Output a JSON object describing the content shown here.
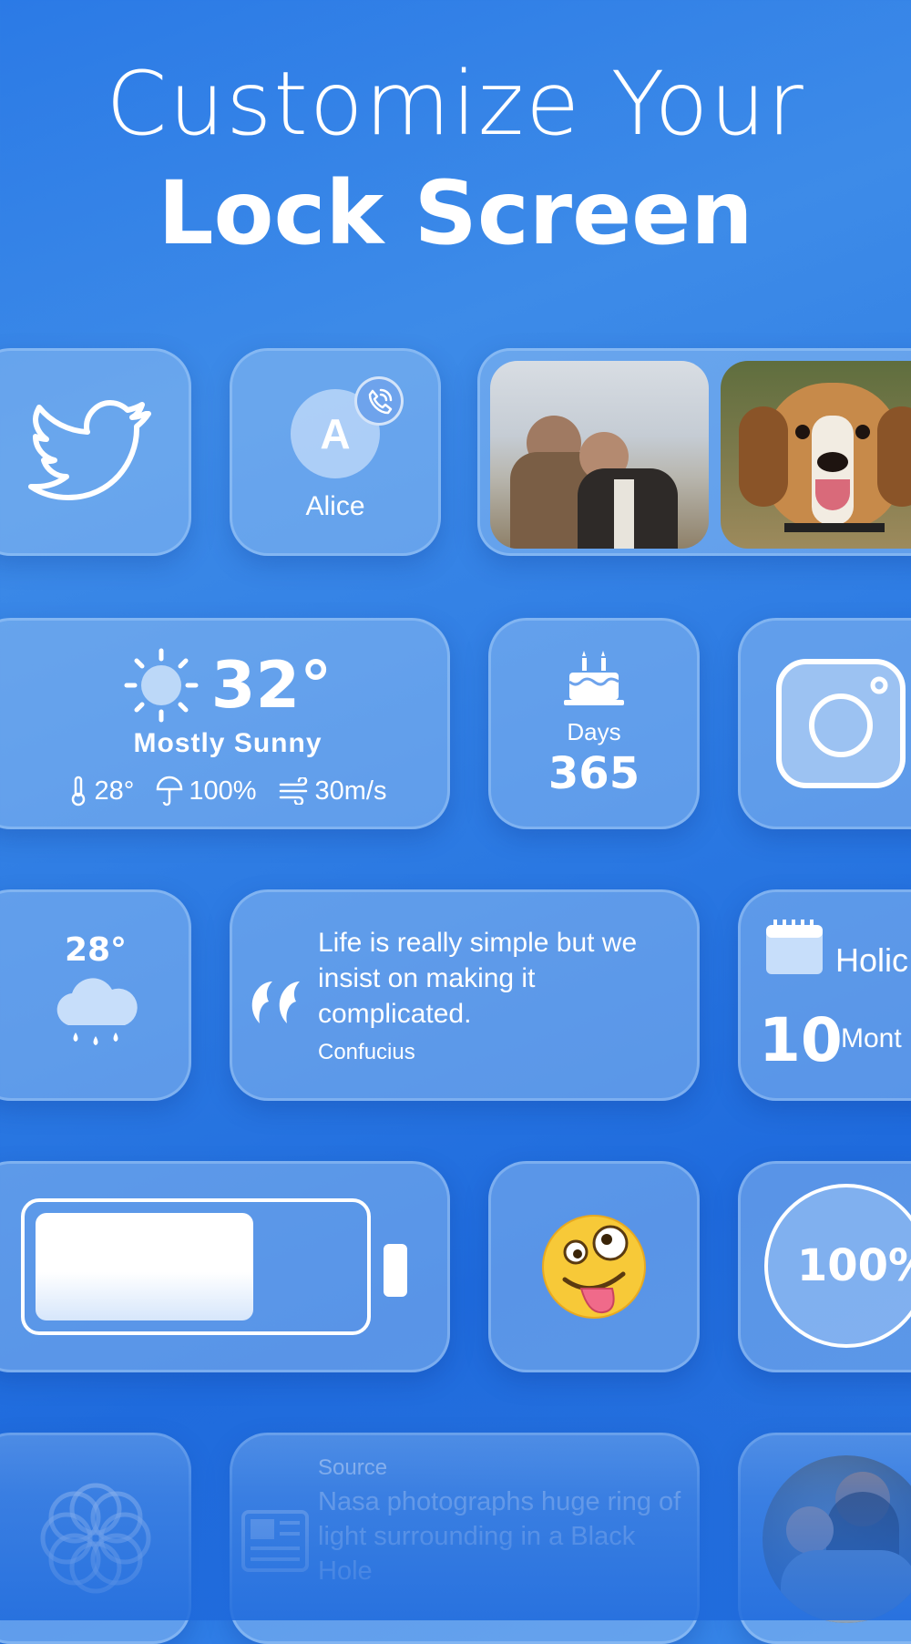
{
  "header": {
    "line1": "Customize Your",
    "line2": "Lock Screen"
  },
  "widgets": {
    "twitter": {
      "icon": "twitter-bird-icon"
    },
    "contact": {
      "initial": "A",
      "name": "Alice",
      "icon": "phone-call-icon"
    },
    "photos": {
      "items": [
        "photo-two-women",
        "photo-beagle-dog"
      ]
    },
    "weather": {
      "temp": "32°",
      "condition": "Mostly Sunny",
      "low": "28°",
      "precip": "100%",
      "wind": "30m/s",
      "icons": [
        "sun-icon",
        "thermometer-icon",
        "umbrella-icon",
        "wind-icon"
      ]
    },
    "countdown": {
      "label": "Days",
      "value": "365",
      "icon": "birthday-cake-icon"
    },
    "instagram": {
      "icon": "instagram-icon"
    },
    "rain": {
      "temp": "28°",
      "icon": "rain-cloud-icon"
    },
    "quote": {
      "text": "Life is really simple but we insist on making it complicated.",
      "author": "Confucius",
      "icon": "quote-marks-icon"
    },
    "holiday": {
      "title": "Holic",
      "value": "10",
      "unit": "Mont",
      "icon": "calendar-icon"
    },
    "battery": {
      "level": 0.68,
      "icon": "battery-icon"
    },
    "emoji": {
      "icon": "zany-face-emoji-icon"
    },
    "percent": {
      "value": "100%"
    },
    "flower": {
      "icon": "flower-icon"
    },
    "news": {
      "source": "Source",
      "headline": "Nasa photographs huge ring of light surrounding in a Black Hole",
      "icon": "newspaper-icon"
    },
    "family": {
      "icon": "family-photo"
    }
  },
  "colors": {
    "background": "#2b7ae6",
    "tile": "#8fbaf0",
    "text": "#ffffff"
  }
}
